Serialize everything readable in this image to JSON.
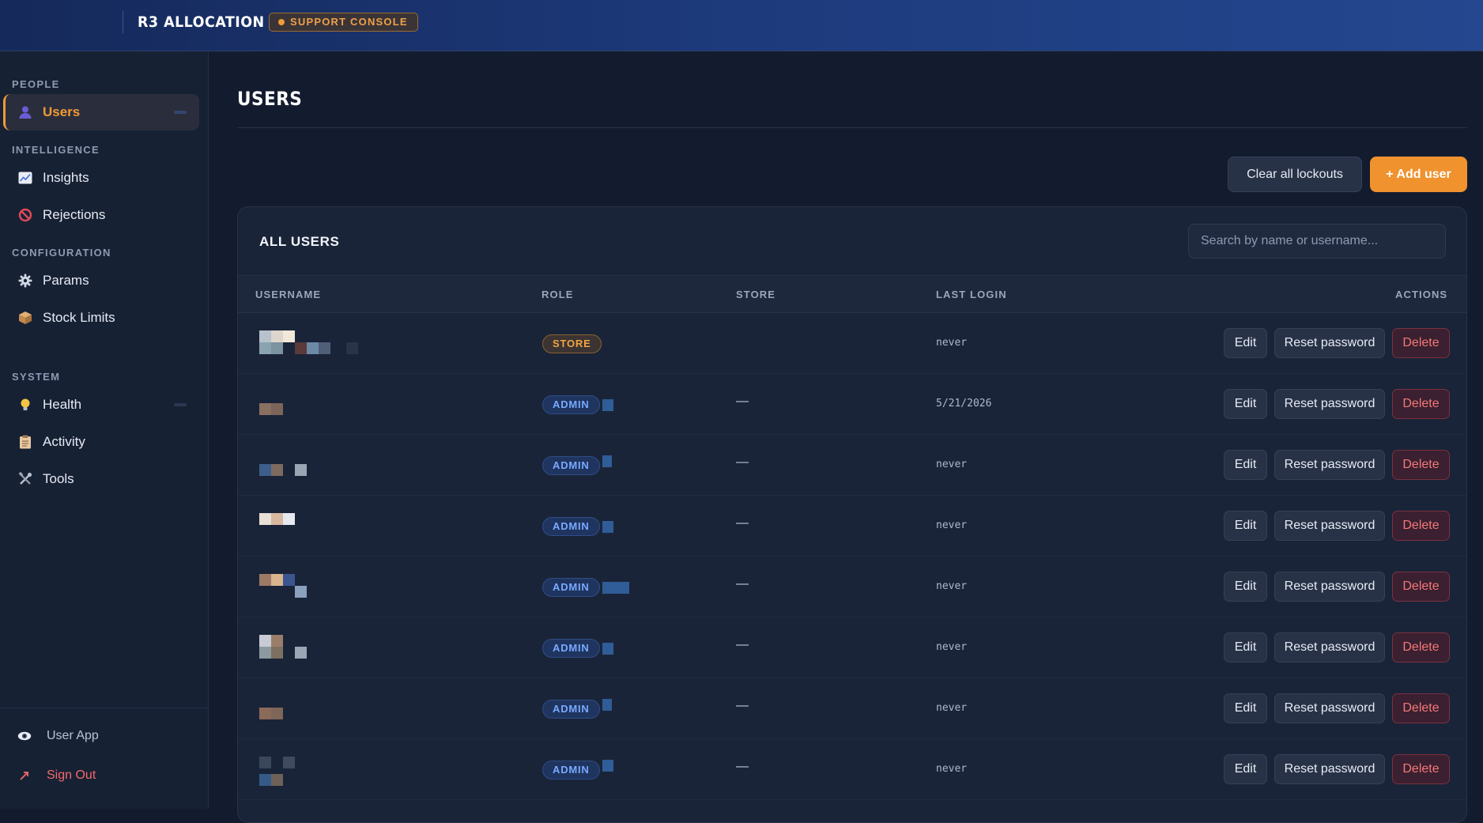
{
  "header": {
    "app_title": "R3 ALLOCATION",
    "console_badge": "SUPPORT CONSOLE"
  },
  "sidebar": {
    "sections": [
      {
        "label": "PEOPLE"
      },
      {
        "label": "INTELLIGENCE"
      },
      {
        "label": "CONFIGURATION"
      },
      {
        "label": "SYSTEM"
      }
    ],
    "items": [
      {
        "label": "Users",
        "icon": "user-icon",
        "active": true
      },
      {
        "label": "Insights",
        "icon": "chart-icon"
      },
      {
        "label": "Rejections",
        "icon": "no-entry-icon"
      },
      {
        "label": "Params",
        "icon": "gear-icon"
      },
      {
        "label": "Stock Limits",
        "icon": "package-icon"
      },
      {
        "label": "Health",
        "icon": "lightbulb-icon"
      },
      {
        "label": "Activity",
        "icon": "clipboard-icon"
      },
      {
        "label": "Tools",
        "icon": "tools-icon"
      }
    ],
    "footer": {
      "user_app": "User App",
      "sign_out": "Sign Out"
    }
  },
  "page": {
    "title": "USERS",
    "clear_lockouts": "Clear all lockouts",
    "add_user": "+ Add user"
  },
  "users_card": {
    "title": "ALL USERS",
    "search_placeholder": "Search by name or username...",
    "columns": {
      "username": "USERNAME",
      "role": "ROLE",
      "store": "STORE",
      "last_login": "LAST LOGIN",
      "actions": "ACTIONS"
    },
    "actions": {
      "edit": "Edit",
      "reset": "Reset password",
      "delete": "Delete"
    },
    "rows": [
      {
        "role": "STORE",
        "store": "",
        "last_login": "never"
      },
      {
        "role": "ADMIN",
        "store": "—",
        "last_login": "5/21/2026"
      },
      {
        "role": "ADMIN",
        "store": "—",
        "last_login": "never"
      },
      {
        "role": "ADMIN",
        "store": "—",
        "last_login": "never"
      },
      {
        "role": "ADMIN",
        "store": "—",
        "last_login": "never"
      },
      {
        "role": "ADMIN",
        "store": "—",
        "last_login": "never"
      },
      {
        "role": "ADMIN",
        "store": "—",
        "last_login": "never"
      },
      {
        "role": "ADMIN",
        "store": "—",
        "last_login": "never"
      }
    ]
  },
  "colors": {
    "accent": "#f0922e",
    "admin_badge": "#79a9ff",
    "danger": "#f57878"
  }
}
